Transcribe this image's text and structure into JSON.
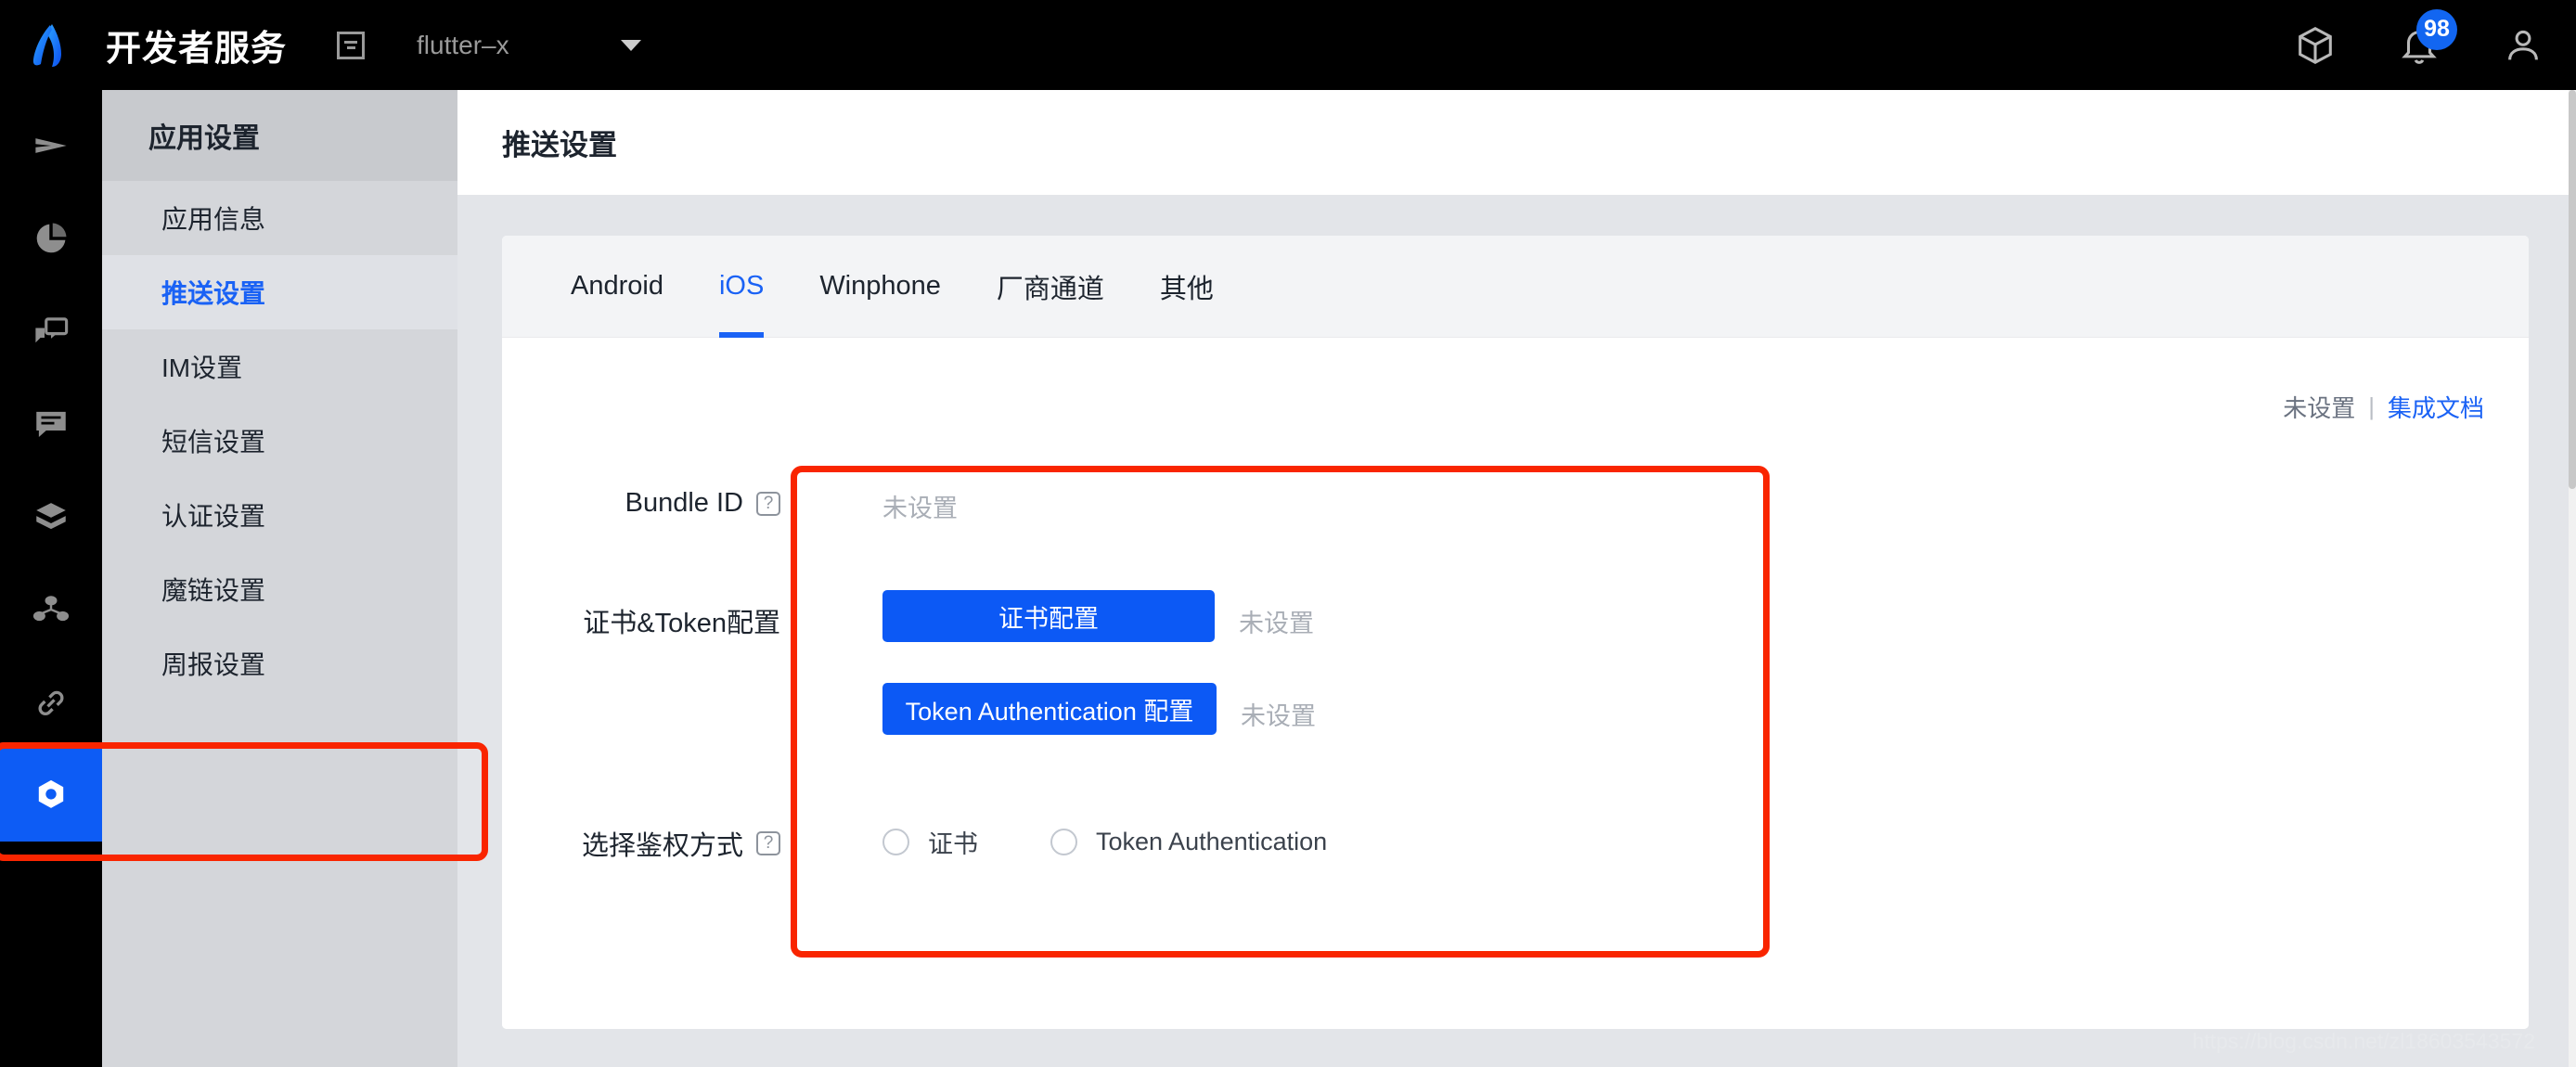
{
  "header": {
    "logo_icon": "jiguang-logo-icon",
    "brand_title": "开发者服务",
    "app_doc_icon": "document-list-icon",
    "app_name": "flutter–x",
    "chevron_icon": "chevron-down-icon",
    "cube_icon": "cube-icon",
    "bell_icon": "bell-icon",
    "notification_count": "98",
    "user_icon": "user-avatar-icon"
  },
  "rail": {
    "items": [
      {
        "name": "send-icon",
        "label": "推送"
      },
      {
        "name": "pie-chart-icon",
        "label": "统计"
      },
      {
        "name": "message-push-icon",
        "label": "消息"
      },
      {
        "name": "chat-icon",
        "label": "会话"
      },
      {
        "name": "shield-icon",
        "label": "认证"
      },
      {
        "name": "share-network-icon",
        "label": "分享"
      },
      {
        "name": "link-icon",
        "label": "魔链"
      },
      {
        "name": "gear-icon",
        "label": "设置",
        "active": true
      }
    ]
  },
  "sidebar": {
    "title": "应用设置",
    "items": [
      {
        "label": "应用信息",
        "active": false
      },
      {
        "label": "推送设置",
        "active": true
      },
      {
        "label": "IM设置",
        "active": false
      },
      {
        "label": "短信设置",
        "active": false
      },
      {
        "label": "认证设置",
        "active": false
      },
      {
        "label": "魔链设置",
        "active": false
      },
      {
        "label": "周报设置",
        "active": false
      }
    ]
  },
  "page": {
    "title": "推送设置"
  },
  "tabs": [
    {
      "label": "Android",
      "active": false
    },
    {
      "label": "iOS",
      "active": true
    },
    {
      "label": "Winphone",
      "active": false
    },
    {
      "label": "厂商通道",
      "active": false
    },
    {
      "label": "其他",
      "active": false
    }
  ],
  "status": {
    "unset_text": "未设置",
    "separator": "|",
    "doc_link": "集成文档"
  },
  "form": {
    "bundle_id": {
      "label": "Bundle ID",
      "help_icon": "help-question-icon",
      "help_glyph": "?",
      "value": "未设置"
    },
    "cert_token": {
      "label": "证书&Token配置",
      "cert_button": "证书配置",
      "cert_status": "未设置",
      "token_button": "Token Authentication 配置",
      "token_status": "未设置"
    },
    "auth_mode": {
      "label": "选择鉴权方式",
      "help_icon": "help-question-icon",
      "help_glyph": "?",
      "options": [
        {
          "label": "证书",
          "selected": false
        },
        {
          "label": "Token Authentication",
          "selected": false
        }
      ]
    }
  },
  "annotations": {
    "form_highlight_color": "#f92500",
    "rail_highlight_color": "#f92500"
  },
  "watermark": "https://blog.csdn.net/zl18603543572",
  "colors": {
    "accent_blue": "#1a62f5",
    "button_blue": "#0c59f5",
    "badge_blue": "#1266f1",
    "dark_bg": "#000000",
    "sidebar_bg": "#d4d6da",
    "content_bg": "#e3e5e9"
  }
}
